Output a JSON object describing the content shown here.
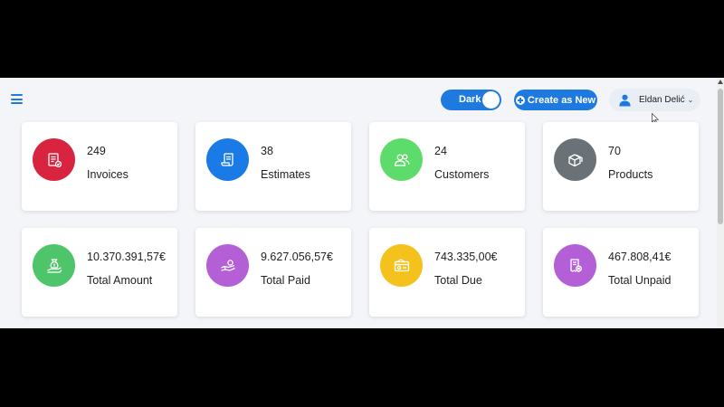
{
  "header": {
    "theme_toggle_label": "Dark",
    "create_label": "Create as New",
    "user_name": "Eldan Delić",
    "user_chevron": "⌄"
  },
  "colors": {
    "accent": "#1f7ae0",
    "invoices": "#d8243f",
    "estimates": "#1b7be6",
    "customers": "#5edc6b",
    "products": "#6b7277",
    "total_amount": "#4fc56b",
    "total_paid": "#b45fd6",
    "total_due": "#f5c21d",
    "total_unpaid": "#b45fd6"
  },
  "cards": [
    {
      "value": "249",
      "label": "Invoices",
      "icon": "invoice-icon"
    },
    {
      "value": "38",
      "label": "Estimates",
      "icon": "estimate-icon"
    },
    {
      "value": "24",
      "label": "Customers",
      "icon": "customers-icon"
    },
    {
      "value": "70",
      "label": "Products",
      "icon": "products-icon"
    },
    {
      "value": "10.370.391,57€",
      "label": "Total Amount",
      "icon": "money-bag-icon"
    },
    {
      "value": "9.627.056,57€",
      "label": "Total Paid",
      "icon": "hand-payment-icon"
    },
    {
      "value": "743.335,00€",
      "label": "Total Due",
      "icon": "card-due-icon"
    },
    {
      "value": "467.808,41€",
      "label": "Total Unpaid",
      "icon": "receipt-unpaid-icon"
    }
  ]
}
